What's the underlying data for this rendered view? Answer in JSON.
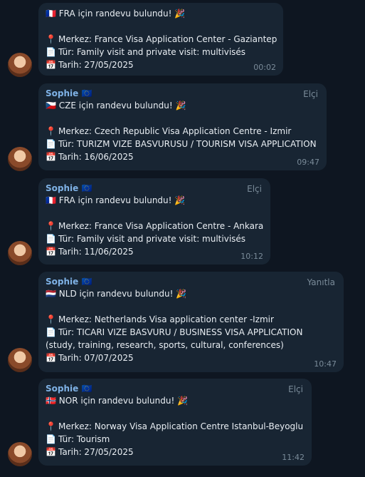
{
  "messages": [
    {
      "sender": "",
      "role": "",
      "flag": "🇫🇷",
      "headline": "FRA için randevu bulundu! 🎉",
      "center": "Merkez: France Visa Application Center - Gaziantep",
      "type": "Tür: Family visit and private visit: multivisés",
      "date": "Tarih: 27/05/2025",
      "time": "00:02"
    },
    {
      "sender": "Sophie 🇪🇺",
      "role": "Elçi",
      "flag": "🇨🇿",
      "headline": "CZE için randevu bulundu! 🎉",
      "center": "Merkez: Czech Republic Visa Application Centre - Izmir",
      "type": "Tür: TURIZM VIZE BASVURUSU / TOURISM VISA APPLICATION",
      "date": "Tarih: 16/06/2025",
      "time": "09:47"
    },
    {
      "sender": "Sophie 🇪🇺",
      "role": "Elçi",
      "flag": "🇫🇷",
      "headline": "FRA için randevu bulundu! 🎉",
      "center": "Merkez: France Visa Application Centre - Ankara",
      "type": "Tür: Family visit and private visit: multivisés",
      "date": "Tarih: 11/06/2025",
      "time": "10:12"
    },
    {
      "sender": "Sophie 🇪🇺",
      "role": "Yanıtla",
      "flag": "🇳🇱",
      "headline": "NLD için randevu bulundu! 🎉",
      "center": "Merkez: Netherlands Visa application center -Izmir",
      "type": "Tür: TICARI VIZE BASVURU / BUSINESS VISA APPLICATION (study, training, research, sports, cultural, conferences)",
      "date": "Tarih: 07/07/2025",
      "time": "10:47"
    },
    {
      "sender": "Sophie 🇪🇺",
      "role": "Elçi",
      "flag": "🇳🇴",
      "headline": "NOR için randevu bulundu! 🎉",
      "center": "Merkez: Norway Visa Application Centre Istanbul-Beyoglu",
      "type": "Tür: Tourism",
      "date": "Tarih: 27/05/2025",
      "time": "11:42"
    }
  ],
  "icons": {
    "pin": "📍",
    "doc": "📄",
    "calendar": "📅"
  }
}
